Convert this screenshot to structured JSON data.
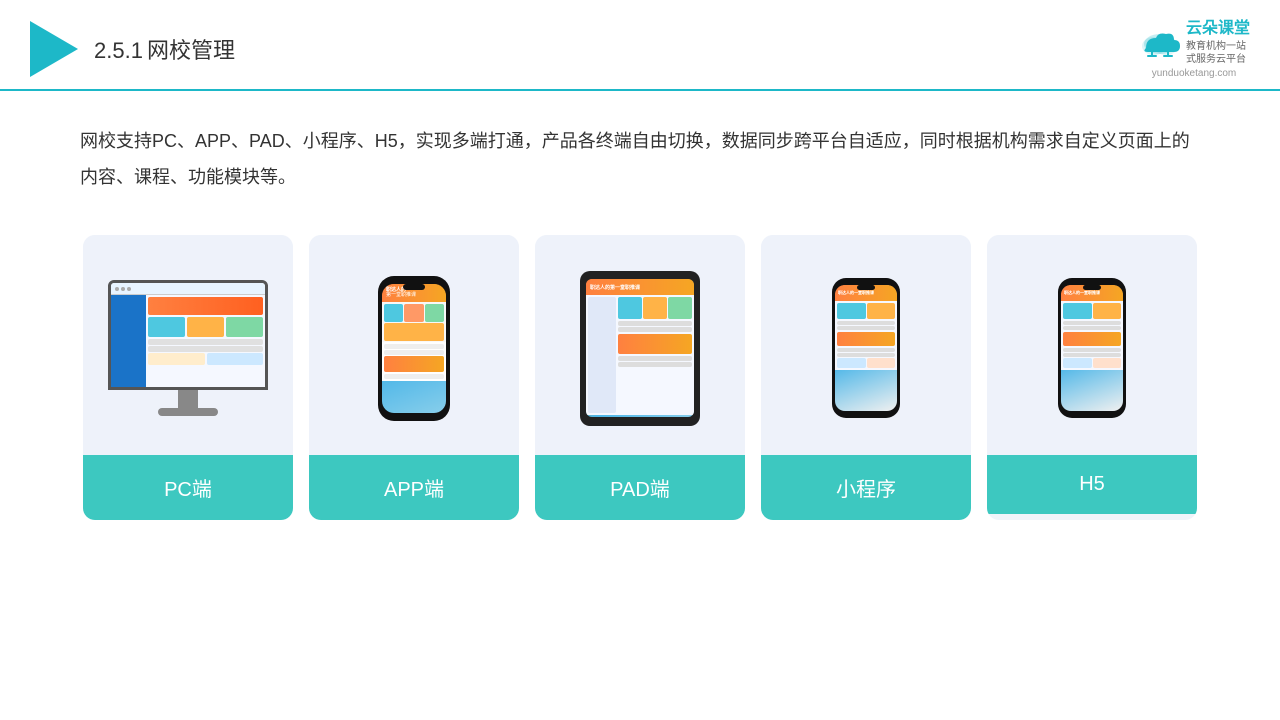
{
  "header": {
    "section_number": "2.5.1",
    "title": "网校管理",
    "logo_main": "云朵课堂",
    "logo_tagline_line1": "教育机构一站",
    "logo_tagline_line2": "式服务云平台",
    "logo_url_text": "yunduoketang.com"
  },
  "description": {
    "text": "网校支持PC、APP、PAD、小程序、H5，实现多端打通，产品各终端自由切换，数据同步跨平台自适应，同时根据机构需求自定义页面上的内容、课程、功能模块等。"
  },
  "cards": [
    {
      "id": "pc",
      "label": "PC端"
    },
    {
      "id": "app",
      "label": "APP端"
    },
    {
      "id": "pad",
      "label": "PAD端"
    },
    {
      "id": "miniapp",
      "label": "小程序"
    },
    {
      "id": "h5",
      "label": "H5"
    }
  ]
}
